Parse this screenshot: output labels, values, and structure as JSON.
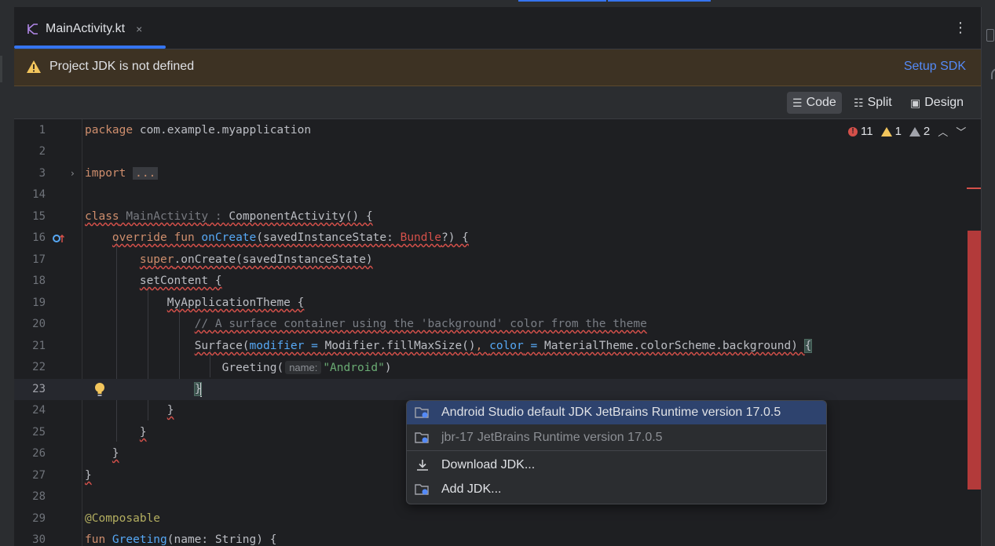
{
  "tab": {
    "filename": "MainActivity.kt",
    "close": "×"
  },
  "banner": {
    "message": "Project JDK is not defined",
    "action": "Setup SDK"
  },
  "modes": {
    "code": "Code",
    "split": "Split",
    "design": "Design"
  },
  "inspections": {
    "errors": "11",
    "warnings": "1",
    "weak_warnings": "2"
  },
  "lines": {
    "l1": "1",
    "l2": "2",
    "l3": "3",
    "l14": "14",
    "l15": "15",
    "l16": "16",
    "l17": "17",
    "l18": "18",
    "l19": "19",
    "l20": "20",
    "l21": "21",
    "l22": "22",
    "l23": "23",
    "l24": "24",
    "l25": "25",
    "l26": "26",
    "l27": "27",
    "l28": "28",
    "l29": "29",
    "l30": "30"
  },
  "code": {
    "package_kw": "package",
    "package_name": " com.example.myapplication",
    "import_kw": "import",
    "import_fold": "...",
    "class_kw": "class",
    "class_name": " MainActivity",
    "class_colon": " : ",
    "class_super": "ComponentActivity() {",
    "override_kw": "override fun ",
    "oncreate": "onCreate",
    "oncreate_params": "(savedInstanceState: ",
    "bundle": "Bundle",
    "oncreate_tail": "?) {",
    "super_kw": "super",
    "super_call": ".onCreate(savedInstanceState)",
    "setcontent": "setContent {",
    "theme": "MyApplicationTheme {",
    "comment": "// A surface container using the 'background' color from the theme",
    "surface_start": "Surface(",
    "modifier_param": "modifier",
    "eq1": " = ",
    "modifier_val": "Modifier.fillMaxSize()",
    "comma": ", ",
    "color_param": "color",
    "eq2": " = ",
    "color_val": "MaterialTheme.colorScheme.background) ",
    "brace_open": "{",
    "greeting_call": "Greeting(",
    "inlay_name": "name:",
    "greeting_str": "\"Android\"",
    "greeting_close": ")",
    "close_brace": "}",
    "composable": "@Composable",
    "fun_kw": "fun ",
    "greeting_fn": "Greeting",
    "greeting_params": "(name: String) {"
  },
  "popup": {
    "item1": "Android Studio default JDK JetBrains Runtime version 17.0.5",
    "item2_main": "jbr-17",
    "item2_sub": "JetBrains Runtime version 17.0.5",
    "item3": "Download JDK...",
    "item4": "Add JDK..."
  },
  "colors": {
    "accent": "#3574f0",
    "error": "#d4504a",
    "warning_bg": "#3d3223",
    "selection": "#2e436e"
  }
}
